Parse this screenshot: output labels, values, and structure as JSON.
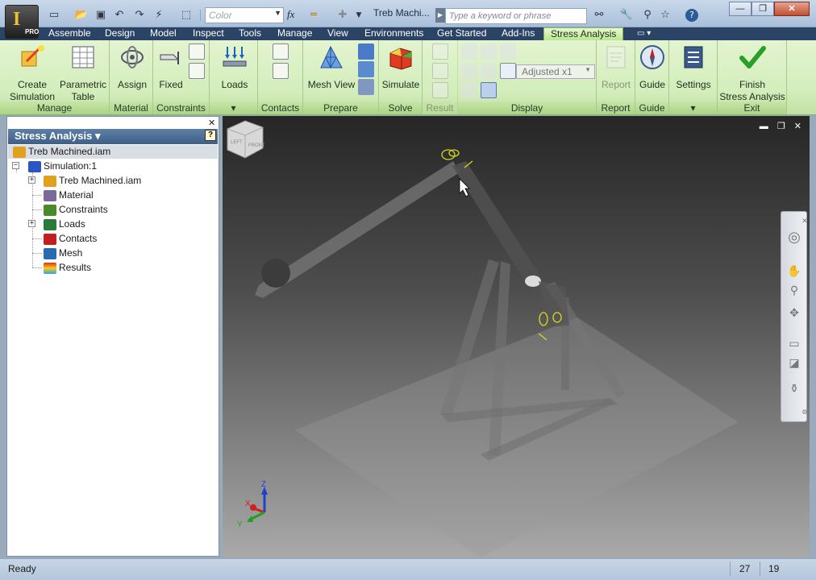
{
  "app": {
    "logo_letter": "I",
    "edition": "PRO",
    "title": "Treb Machi..."
  },
  "quick_access": {
    "color_placeholder": "Color",
    "fx_symbol": "fx"
  },
  "search": {
    "placeholder": "Type a keyword or phrase"
  },
  "window_controls": {
    "minimize": "—",
    "restore": "❐",
    "close": "✕"
  },
  "tabs": [
    "Assemble",
    "Design",
    "Model",
    "Inspect",
    "Tools",
    "Manage",
    "View",
    "Environments",
    "Get Started",
    "Add-Ins",
    "Stress Analysis"
  ],
  "active_tab": "Stress Analysis",
  "ribbon": {
    "panels": {
      "manage": "Manage",
      "material": "Material",
      "constraints": "Constraints",
      "loads_more": "▾",
      "contacts": "Contacts",
      "prepare": "Prepare",
      "solve": "Solve",
      "result": "Result",
      "display": "Display",
      "report": "Report",
      "guide": "Guide",
      "settings_more": "▾",
      "exit": "Exit"
    },
    "buttons": {
      "create_simulation_1": "Create",
      "create_simulation_2": "Simulation",
      "parametric_table_1": "Parametric",
      "parametric_table_2": "Table",
      "assign": "Assign",
      "fixed": "Fixed",
      "loads": "Loads",
      "mesh_view": "Mesh View",
      "simulate": "Simulate",
      "adjusted": "Adjusted x1",
      "report": "Report",
      "guide": "Guide",
      "settings": "Settings",
      "finish_1": "Finish",
      "finish_2": "Stress Analysis"
    }
  },
  "browser": {
    "title": "Stress Analysis ▾",
    "help": "?",
    "close": "✕",
    "root": "Treb Machined.iam",
    "items": [
      {
        "label": "Simulation:1",
        "icon": "simulation-icon",
        "color": "#2b55c4"
      },
      {
        "label": "Treb Machined.iam",
        "icon": "assembly-icon",
        "color": "#e0a020"
      },
      {
        "label": "Material",
        "icon": "material-icon",
        "color": "#7a6a9a"
      },
      {
        "label": "Constraints",
        "icon": "constraints-icon",
        "color": "#4a8a2a"
      },
      {
        "label": "Loads",
        "icon": "loads-icon",
        "color": "#2a7a3a"
      },
      {
        "label": "Contacts",
        "icon": "contacts-icon",
        "color": "#c02020"
      },
      {
        "label": "Mesh",
        "icon": "mesh-icon",
        "color": "#2a6ab0"
      },
      {
        "label": "Results",
        "icon": "results-icon",
        "color": "#e08020"
      }
    ]
  },
  "viewport": {
    "viewcube_front": "FRONT",
    "viewcube_left": "LEFT",
    "axis_x": "X",
    "axis_y": "Y",
    "axis_z": "Z"
  },
  "status": {
    "text": "Ready",
    "value_1": "27",
    "value_2": "19"
  }
}
